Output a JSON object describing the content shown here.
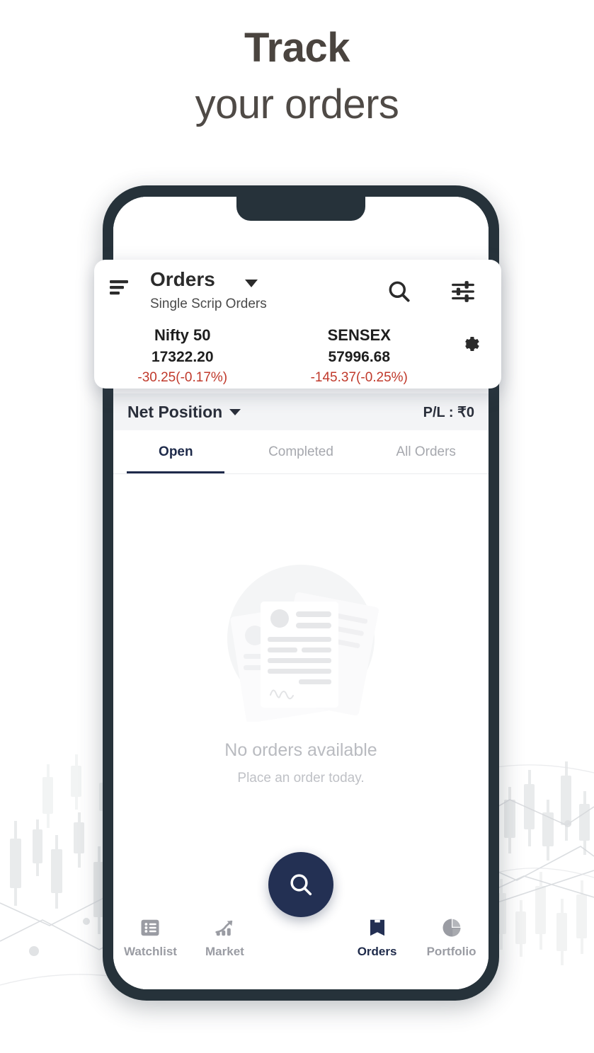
{
  "promo": {
    "headline_line1": "Track",
    "headline_line2": "your orders"
  },
  "header_card": {
    "menu_icon": "hamburger-menu-icon",
    "title": "Orders",
    "title_caret": "chevron-down-icon",
    "subtitle": "Single Scrip Orders",
    "search_icon": "search-icon",
    "filter_icon": "filter-sliders-icon",
    "gear_icon": "gear-icon",
    "indices": [
      {
        "name": "Nifty 50",
        "value": "17322.20",
        "change": "-30.25(-0.17%)"
      },
      {
        "name": "SENSEX",
        "value": "57996.68",
        "change": "-145.37(-0.25%)"
      }
    ]
  },
  "subheader": {
    "net_position_label": "Net Position",
    "caret_icon": "chevron-down-icon",
    "pl_label": "P/L : ₹0"
  },
  "tabs": [
    {
      "label": "Open",
      "active": true
    },
    {
      "label": "Completed",
      "active": false
    },
    {
      "label": "All Orders",
      "active": false
    }
  ],
  "empty_state": {
    "illustration": "documents-stack-illustration",
    "title": "No orders available",
    "subtitle": "Place an order today."
  },
  "fab": {
    "icon": "search-icon"
  },
  "bottom_nav": [
    {
      "label": "Watchlist",
      "icon": "list-icon",
      "active": false
    },
    {
      "label": "Market",
      "icon": "bar-chart-arrow-icon",
      "active": false
    },
    {
      "label": "Orders",
      "icon": "book-icon",
      "active": true
    },
    {
      "label": "Portfolio",
      "icon": "pie-chart-icon",
      "active": false
    }
  ],
  "colors": {
    "brand_navy": "#233053",
    "tab_active": "#1e2a4a",
    "negative_red": "#c0392b",
    "phone_frame": "#26323a",
    "headline_text": "#4a443f",
    "subheader_bg": "#f3f4f6"
  }
}
